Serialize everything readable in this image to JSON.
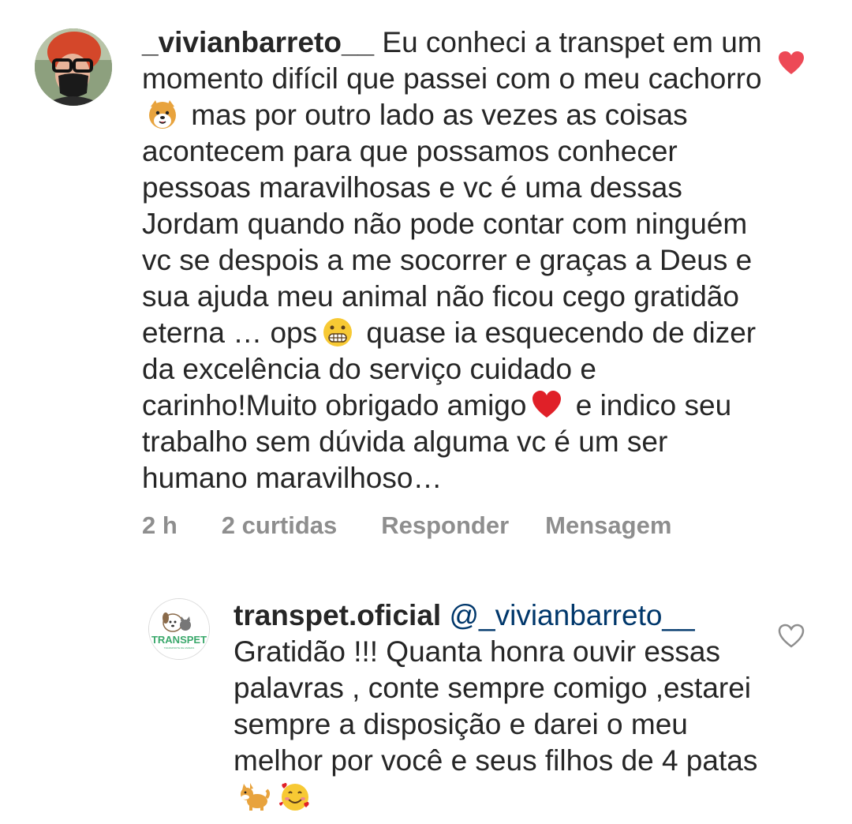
{
  "comments": [
    {
      "username": "_vivianbarreto__",
      "text_parts": [
        " Eu conheci a transpet em um momento difícil que passei com o meu cachorro",
        " mas por outro lado as vezes as coisas acontecem para que possamos conhecer pessoas maravilhosas e vc é uma dessas Jordam quando não pode contar com ninguém vc se despois a me socorrer e graças a Deus e sua ajuda meu animal não ficou cego gratidão eterna … ops",
        " quase ia esquecendo de dizer da excelência do serviço cuidado e carinho!Muito obrigado amigo",
        " e indico seu trabalho sem dúvida alguma vc é um ser humano maravilhoso…"
      ],
      "emojis": [
        "dog-face-emoji",
        "grimacing-face-emoji",
        "red-heart-emoji"
      ],
      "liked": true,
      "like_color": "#ed4956",
      "time": "2 h",
      "likes": "2 curtidas",
      "reply_label": "Responder",
      "message_label": "Mensagem"
    },
    {
      "username": "transpet.oficial",
      "mention": "@_vivianbarreto__",
      "text": "Gratidão !!! Quanta honra ouvir essas palavras , conte sempre comigo ,estarei sempre a disposição e darei o meu melhor por você e seus filhos de 4 patas",
      "emojis": [
        "shiba-dog-emoji",
        "smiling-face-with-hearts-emoji"
      ],
      "liked": false,
      "logo_text": "TRANSPET"
    }
  ]
}
